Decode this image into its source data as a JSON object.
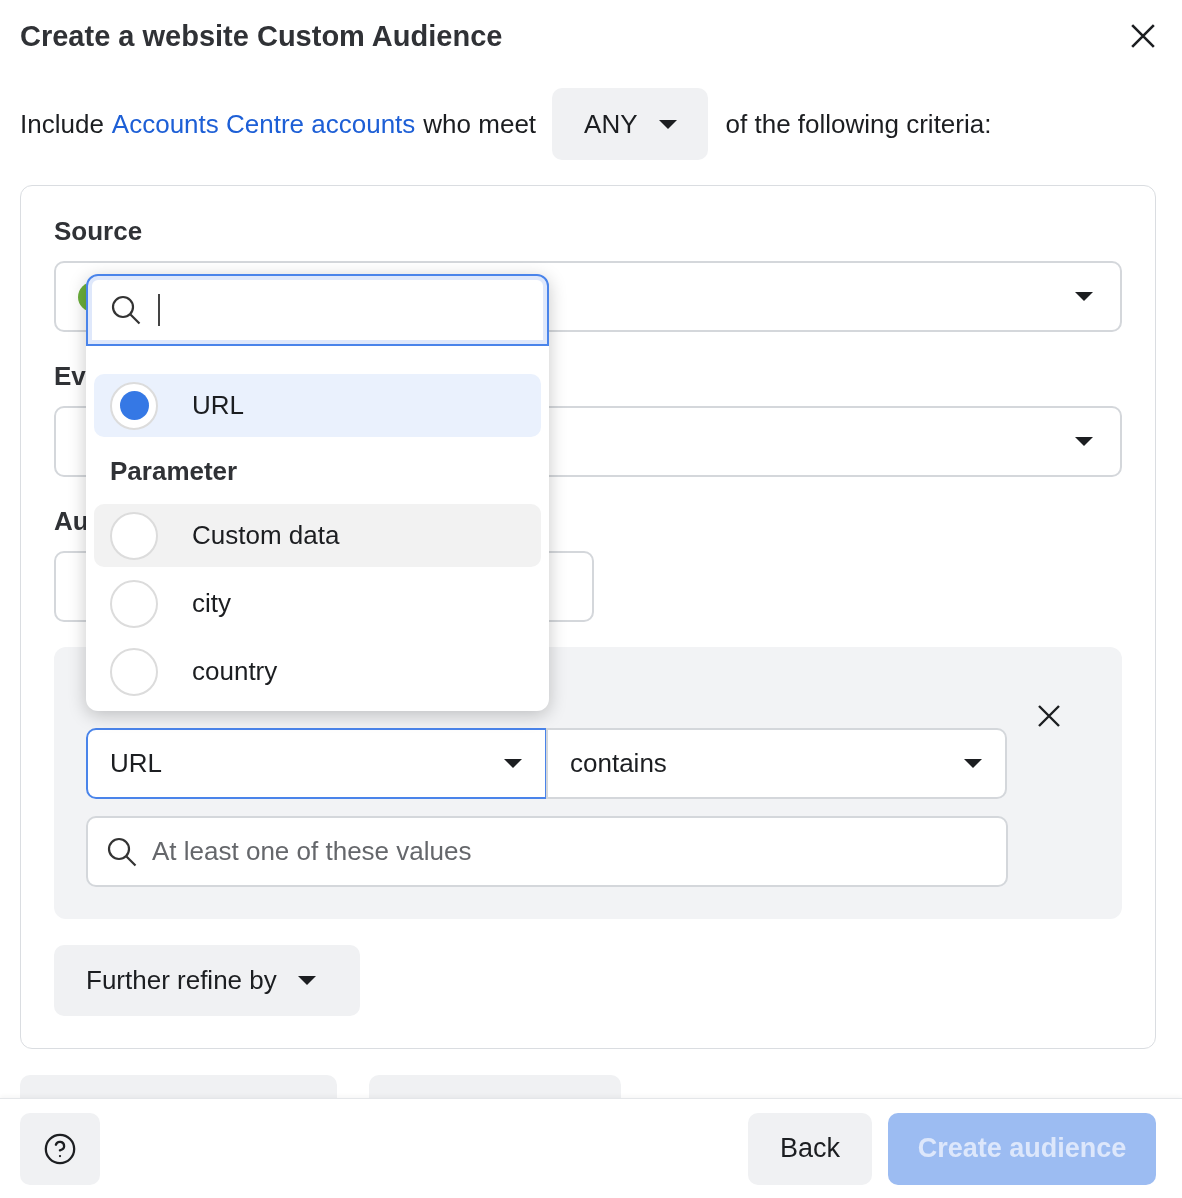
{
  "dialog": {
    "title": "Create a website Custom Audience"
  },
  "criteria": {
    "prefix": "Include",
    "link": "Accounts Centre accounts",
    "middle": "who meet",
    "match": "ANY",
    "suffix": "of the following criteria:"
  },
  "form": {
    "source_label": "Source",
    "event_label": "Ev",
    "audience_label": "Au"
  },
  "rule": {
    "field": "URL",
    "operator": "contains",
    "values_placeholder": "At least one of these values"
  },
  "refine": "Further refine by",
  "dropdown": {
    "options": [
      {
        "kind": "option",
        "label": "URL",
        "selected": true,
        "hovered": false
      },
      {
        "kind": "heading",
        "label": "Parameter"
      },
      {
        "kind": "option",
        "label": "Custom data",
        "selected": false,
        "hovered": true
      },
      {
        "kind": "option",
        "label": "city",
        "selected": false,
        "hovered": false
      },
      {
        "kind": "option",
        "label": "country",
        "selected": false,
        "hovered": false
      }
    ]
  },
  "footer": {
    "back": "Back",
    "create": "Create audience",
    "create_disabled": true
  }
}
